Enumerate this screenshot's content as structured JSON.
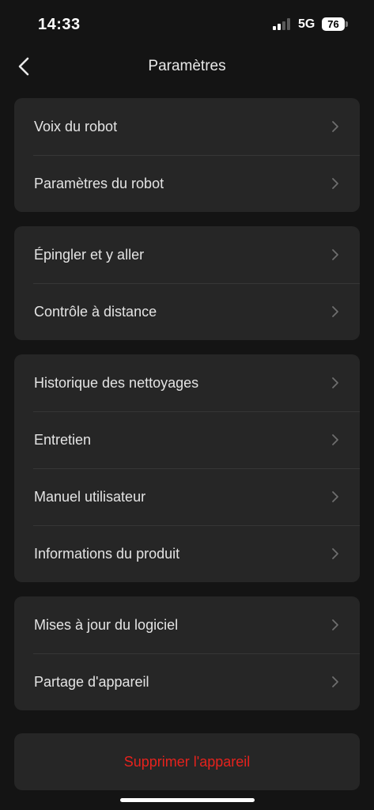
{
  "status_bar": {
    "time": "14:33",
    "network": "5G",
    "battery": "76"
  },
  "header": {
    "title": "Paramètres"
  },
  "groups": [
    {
      "items": [
        {
          "label": "Voix du robot"
        },
        {
          "label": "Paramètres du robot"
        }
      ]
    },
    {
      "items": [
        {
          "label": "Épingler et y aller"
        },
        {
          "label": "Contrôle à distance"
        }
      ]
    },
    {
      "items": [
        {
          "label": "Historique des nettoyages"
        },
        {
          "label": "Entretien"
        },
        {
          "label": "Manuel utilisateur"
        },
        {
          "label": "Informations du produit"
        }
      ]
    },
    {
      "items": [
        {
          "label": "Mises à jour du logiciel"
        },
        {
          "label": "Partage d'appareil"
        }
      ]
    }
  ],
  "delete_button": {
    "label": "Supprimer l'appareil"
  },
  "colors": {
    "background": "#141414",
    "card": "#262626",
    "text": "#e4e4e4",
    "chevron": "#6e6e6e",
    "danger": "#e6221d"
  },
  "icons": {
    "back": "chevron-left-icon",
    "row_arrow": "chevron-right-icon",
    "signal": "cellular-signal-icon",
    "battery": "battery-icon"
  }
}
